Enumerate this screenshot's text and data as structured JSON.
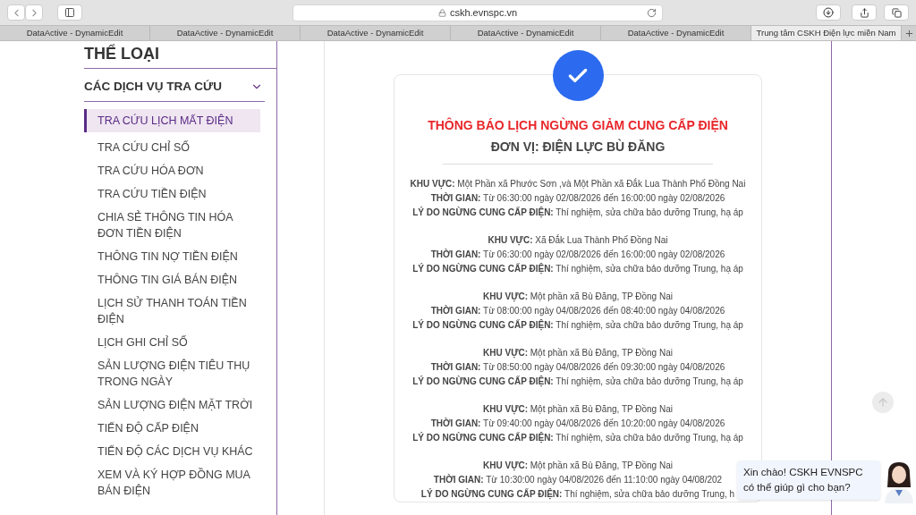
{
  "browser": {
    "url": "cskh.evnspc.vn",
    "tabs": [
      {
        "label": "DataActive - DynamicEdit",
        "selected": false
      },
      {
        "label": "DataActive - DynamicEdit",
        "selected": false
      },
      {
        "label": "DataActive - DynamicEdit",
        "selected": false
      },
      {
        "label": "DataActive - DynamicEdit",
        "selected": false
      },
      {
        "label": "DataActive - DynamicEdit",
        "selected": false
      },
      {
        "label": "Trung tâm CSKH Điện lực miền Nam",
        "selected": true
      }
    ]
  },
  "sidebar": {
    "heading": "THỂ LOẠI",
    "section": {
      "title": "CÁC DỊCH VỤ TRA CỨU",
      "expanded": true
    },
    "items": [
      {
        "label": "TRA CỨU LỊCH MẤT ĐIỆN",
        "selected": true
      },
      {
        "label": "TRA CỨU CHỈ SỐ",
        "selected": false
      },
      {
        "label": "TRA CỨU HÓA ĐƠN",
        "selected": false
      },
      {
        "label": "TRA CỨU TIỀN ĐIỆN",
        "selected": false
      },
      {
        "label": "CHIA SẺ THÔNG TIN HÓA ĐƠN TIỀN ĐIỆN",
        "selected": false
      },
      {
        "label": "THÔNG TIN NỢ TIỀN ĐIỆN",
        "selected": false
      },
      {
        "label": "THÔNG TIN GIÁ BÁN ĐIỆN",
        "selected": false
      },
      {
        "label": "LỊCH SỬ THANH TOÁN TIỀN ĐIỆN",
        "selected": false
      },
      {
        "label": "LỊCH GHI CHỈ SỐ",
        "selected": false
      },
      {
        "label": "SẢN LƯỢNG ĐIỆN TIÊU THỤ TRONG NGÀY",
        "selected": false
      },
      {
        "label": "SẢN LƯỢNG ĐIỆN MẶT TRỜI",
        "selected": false
      },
      {
        "label": "TIẾN ĐỘ CẤP ĐIỆN",
        "selected": false
      },
      {
        "label": "TIẾN ĐỘ CÁC DỊCH VỤ KHÁC",
        "selected": false
      },
      {
        "label": "XEM VÀ KÝ HỢP ĐỒNG MUA BÁN ĐIỆN",
        "selected": false
      }
    ]
  },
  "notice": {
    "title": "THÔNG BÁO LỊCH NGỪNG GIẢM CUNG CẤP ĐIỆN",
    "unit": "ĐƠN VỊ: ĐIỆN LỰC BÙ ĐĂNG",
    "entries": [
      {
        "lines": [
          "**KHU VỰC:** Một Phần xã Phước Sơn ,và Một Phần xã Đắk Lua Thành Phố Đồng Nai",
          "**THỜI GIAN:** Từ 06:30:00 ngày 02/08/2026 đến 16:00:00 ngày 02/08/2026",
          "**LÝ DO NGỪNG CUNG CẤP ĐIỆN:** Thí nghiệm, sửa chữa bảo dưỡng Trung, hạ áp"
        ]
      },
      {
        "lines": [
          "**KHU VỰC:** Xã Đắk Lua Thành Phố Đồng Nai",
          "**THỜI GIAN:** Từ 06:30:00 ngày 02/08/2026 đến 16:00:00 ngày 02/08/2026",
          "**LÝ DO NGỪNG CUNG CẤP ĐIỆN:** Thí nghiệm, sửa chữa bảo dưỡng Trung, hạ áp"
        ]
      },
      {
        "lines": [
          "**KHU VỰC:** Một phần xã Bù Đăng, TP Đồng Nai",
          "**THỜI GIAN:** Từ 08:00:00 ngày 04/08/2026 đến 08:40:00 ngày 04/08/2026",
          "**LÝ DO NGỪNG CUNG CẤP ĐIỆN:** Thí nghiệm, sửa chữa bảo dưỡng Trung, hạ áp"
        ]
      },
      {
        "lines": [
          "**KHU VỰC:** Một phần xã Bù Đăng, TP Đồng Nai",
          "**THỜI GIAN:** Từ 08:50:00 ngày 04/08/2026 đến 09:30:00 ngày 04/08/2026",
          "**LÝ DO NGỪNG CUNG CẤP ĐIỆN:** Thí nghiệm, sửa chữa bảo dưỡng Trung, hạ áp"
        ]
      },
      {
        "lines": [
          "**KHU VỰC:** Một phần xã Bù Đăng, TP Đồng Nai",
          "**THỜI GIAN:** Từ 09:40:00 ngày 04/08/2026 đến 10:20:00 ngày 04/08/2026",
          "**LÝ DO NGỪNG CUNG CẤP ĐIỆN:** Thí nghiệm, sửa chữa bảo dưỡng Trung, hạ áp"
        ]
      },
      {
        "lines": [
          "**KHU VỰC:** Một phần xã Bù Đăng, TP Đồng Nai",
          "**THỜI GIAN:** Từ 10:30:00 ngày 04/08/2026 đến 11:10:00 ngày 04/08/202",
          "**LÝ DO NGỪNG CUNG CẤP ĐIỆN:** Thí nghiệm, sửa chữa bảo dưỡng Trung, h"
        ]
      }
    ]
  },
  "chat": {
    "greeting": "Xin chào! CSKH EVNSPC có thể giúp gì cho bạn?"
  }
}
